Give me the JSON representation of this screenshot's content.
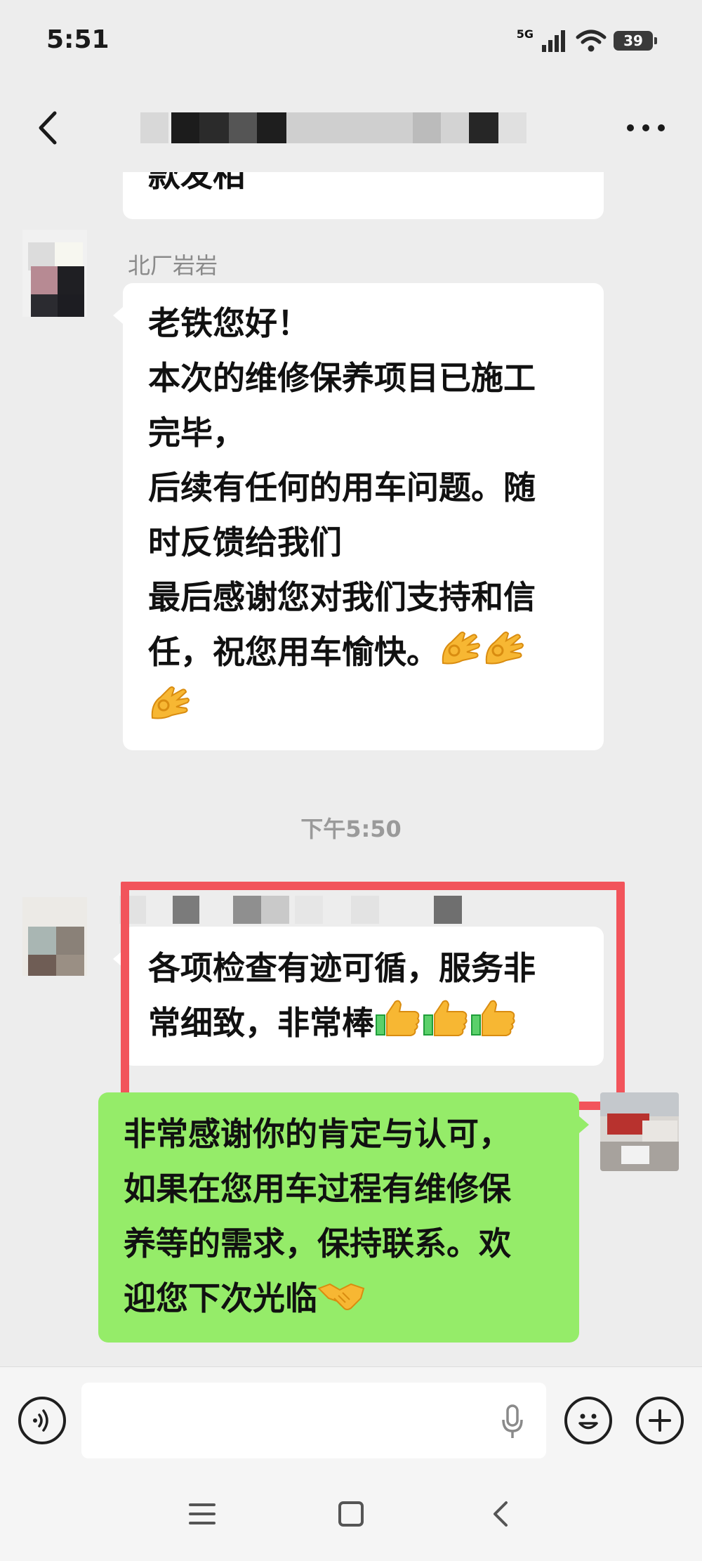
{
  "status_bar": {
    "time": "5:51",
    "network": "5G",
    "battery": "39"
  },
  "nav": {
    "title": ""
  },
  "messages": {
    "top_partial": {
      "text": "款发相"
    },
    "incoming_1": {
      "sender": "北厂岩岩",
      "lines": [
        "老铁您好！",
        "本次的维修保养项目已施工",
        "完毕，",
        "后续有任何的用车问题。随",
        "时反馈给我们",
        "最后感谢您对我们支持和信",
        "任，祝您用车愉快。"
      ]
    },
    "timestamp": "下午5:50",
    "incoming_2": {
      "lines": [
        "各项检查有迹可循，服务非",
        "常细致，非常棒"
      ]
    },
    "outgoing_1": {
      "lines": [
        "非常感谢你的肯定与认可，",
        "如果在您用车过程有维修保",
        "养等的需求，保持联系。欢",
        "迎您下次光临"
      ]
    }
  },
  "input_bar": {
    "value": "",
    "placeholder": ""
  },
  "icons": {
    "back": "chevron-left-icon",
    "more": "ellipsis-icon",
    "voice": "voice-icon",
    "mic": "microphone-icon",
    "emoji": "smiley-icon",
    "plus": "plus-icon",
    "ok_hand": "ok-hand-emoji",
    "thumbs_up": "thumbs-up-emoji",
    "handshake": "handshake-emoji"
  },
  "colors": {
    "background": "#ededed",
    "incoming_bubble": "#ffffff",
    "outgoing_bubble": "#95ec69",
    "highlight": "#f2545b"
  }
}
